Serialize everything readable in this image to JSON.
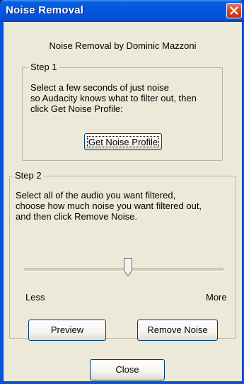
{
  "window": {
    "title": "Noise Removal"
  },
  "credit": "Noise Removal by Dominic Mazzoni",
  "step1": {
    "legend": "Step 1",
    "lines": [
      "Select a few seconds of just noise",
      "so Audacity knows what to filter out, then",
      "click Get Noise Profile:"
    ],
    "button_label": "Get Noise Profile"
  },
  "step2": {
    "legend": "Step 2",
    "lines": [
      "Select all of the audio you want filtered,",
      "choose how much noise you want filtered out,",
      "and then click Remove Noise."
    ],
    "slider": {
      "min_label": "Less",
      "max_label": "More",
      "level": 0.52
    },
    "preview_label": "Preview",
    "remove_label": "Remove Noise"
  },
  "close_label": "Close",
  "colors": {
    "titlebar": "#0554e3",
    "client_bg": "#ece9d8",
    "close_button": "#d84a2a",
    "group_border": "#b9b5a8"
  }
}
